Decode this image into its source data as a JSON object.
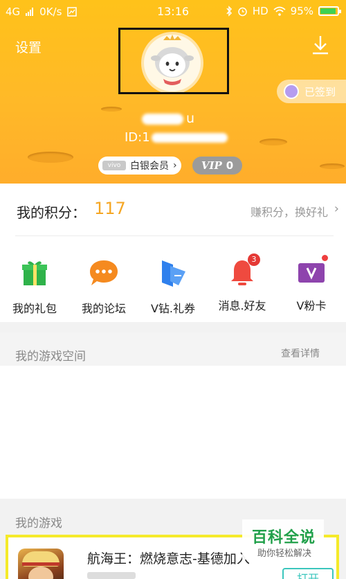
{
  "status_bar": {
    "network": "4G",
    "speed": "0K/s",
    "time": "13:16",
    "hd": "HD",
    "battery": "95%"
  },
  "header": {
    "settings_label": "设置",
    "signin_label": "已签到",
    "username_suffix": "u",
    "user_id_prefix": "ID:1",
    "silver_label": "白银会员",
    "silver_chevron": "›",
    "vip_label": "VIP",
    "vip_level": "0"
  },
  "points": {
    "label": "我的积分：",
    "value": "117",
    "earn_label": "赚积分，换好礼",
    "earn_chevron": "›"
  },
  "grid": [
    {
      "label": "我的礼包",
      "icon": "gift-icon"
    },
    {
      "label": "我的论坛",
      "icon": "chat-bubble-icon"
    },
    {
      "label": "V钻.礼券",
      "icon": "coupon-icon",
      "badge": ""
    },
    {
      "label": "消息.好友",
      "icon": "bell-icon",
      "badge": "3"
    },
    {
      "label": "V粉卡",
      "icon": "vcard-icon"
    }
  ],
  "game_space": {
    "title": "我的游戏空间",
    "detail_label": "查看详情"
  },
  "my_games": {
    "title": "我的游戏",
    "items": [
      {
        "name": "航海王：燃烧意志-基德加入",
        "action": "打开"
      }
    ]
  },
  "watermark": {
    "title": "百科全说",
    "subtitle": "助你轻松解决"
  },
  "colors": {
    "header": "#ffb928",
    "points_value": "#f5a623",
    "open_button": "#3bc6bd",
    "highlight_border": "#f5ea2a"
  }
}
